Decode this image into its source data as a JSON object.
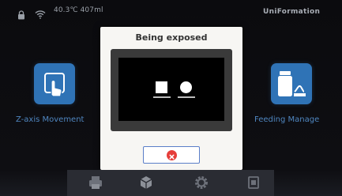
{
  "status_bar": {
    "temperature_text": "40.3℃ 407ml",
    "brand": "UniFormation",
    "icons": [
      "lock-icon",
      "wifi-icon"
    ]
  },
  "tiles": [
    {
      "label": "Z-axis Movement",
      "icon": "hand-tap-icon"
    },
    {
      "label": "Feeding Manage",
      "icon": "resin-bottle-icon"
    }
  ],
  "dialog": {
    "title": "Being exposed",
    "preview_shapes": [
      "square",
      "circle"
    ],
    "stop_icon": "close-circle-icon"
  },
  "bottom_nav": {
    "items": [
      "printer-icon",
      "cube-icon",
      "gear-icon",
      "file-icon"
    ]
  },
  "colors": {
    "background": "#0d0d10",
    "tile_blue": "#2f73b6",
    "label_blue": "#4f86c0",
    "dialog_bg": "#f7f6f3",
    "stop_red": "#e63e3a",
    "nav_bg": "#2a2c33"
  }
}
